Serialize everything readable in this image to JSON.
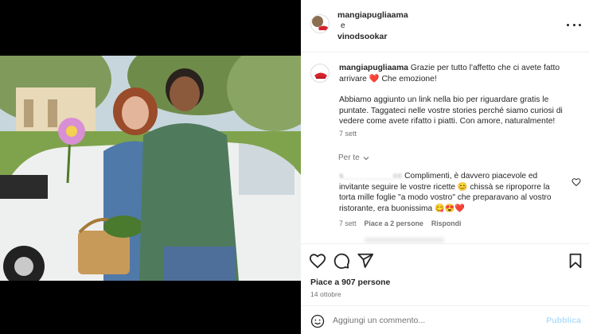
{
  "post": {
    "author": "mangiapugliaama",
    "collab_joiner": "e",
    "collaborator": "vinodsookar",
    "more_icon": "more-dots-icon"
  },
  "caption": {
    "username": "mangiapugliaama",
    "line1": "Grazie per tutto l'affetto che ci avete fatto arrivare",
    "emoji_heart": "❤️",
    "line1_end": "Che emozione!",
    "paragraph2": "Abbiamo aggiunto un link nella bio per riguardare gratis le puntate. Taggateci nelle vostre stories perché siamo curiosi di vedere come avete rifatto i piatti. Con amore, naturalmente!",
    "time": "7 sett"
  },
  "filter": {
    "label": "Per te"
  },
  "comments": [
    {
      "username": "s___________cc",
      "text": "Complimenti, è davvero piacevole ed invitante seguire le vostre ricette 😊 chissà se riproporre la torta mille foglie \"a modo vostro\" che preparavano al vostro ristorante, era buonissima 😋😍❤️",
      "time": "7 sett",
      "likes": "Piace a 2 persone",
      "reply": "Rispondi"
    }
  ],
  "actions": {
    "like_icon": "heart-icon",
    "comment_icon": "comment-icon",
    "share_icon": "send-icon",
    "save_icon": "bookmark-icon"
  },
  "likes_text": "Piace a 907 persone",
  "date": "14 ottobre",
  "add_comment": {
    "placeholder": "Aggiungi un commento...",
    "publish_label": "Pubblica",
    "emoji_icon": "smiley-icon"
  },
  "colors": {
    "publish": "#b2dffc",
    "heart": "#ed1c24"
  }
}
